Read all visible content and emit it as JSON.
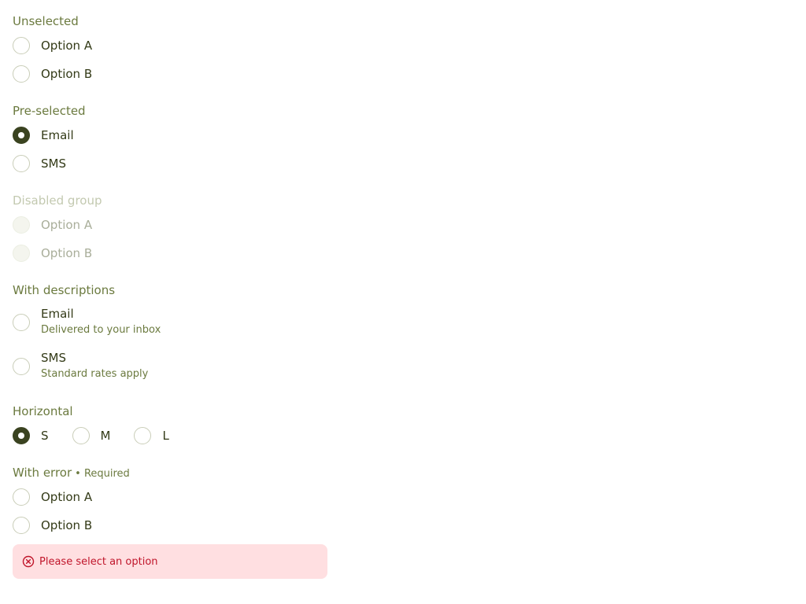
{
  "groups": {
    "unselected": {
      "legend": "Unselected",
      "options": [
        "Option A",
        "Option B"
      ]
    },
    "preselected": {
      "legend": "Pre-selected",
      "options": [
        "Email",
        "SMS"
      ],
      "selected": "Email"
    },
    "disabled": {
      "legend": "Disabled group",
      "options": [
        "Option A",
        "Option B"
      ]
    },
    "descriptions": {
      "legend": "With descriptions",
      "options": [
        {
          "label": "Email",
          "description": "Delivered to your inbox"
        },
        {
          "label": "SMS",
          "description": "Standard rates apply"
        }
      ]
    },
    "horizontal": {
      "legend": "Horizontal",
      "options": [
        "S",
        "M",
        "L"
      ],
      "selected": "S"
    },
    "error": {
      "legend": "With error",
      "required": "• Required",
      "options": [
        "Option A",
        "Option B"
      ],
      "message": "Please select an option",
      "icon": "error-circle-icon",
      "color": "#c0152a",
      "background": "#ffdfe1"
    }
  },
  "colors": {
    "accent": "#3a4320",
    "legend": "#6b7a3f",
    "label": "#333a17"
  }
}
